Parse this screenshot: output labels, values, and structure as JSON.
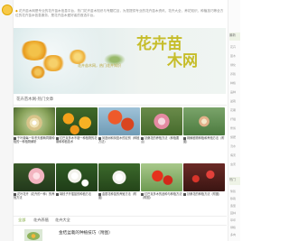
{
  "left_logo": "flower-logo-icon",
  "intro": {
    "mark": "◆",
    "text": "花卉苗木网是专业的花卉苗木信息平台，热门花卉苗木知识与专题栏目，为您提供专业的花卉苗木资讯、花卉大全、养花知识、种植技巧等全方位的花卉苗木信息服务，是花卉苗木爱好者的首选平台。"
  },
  "banner": {
    "title_line1": "花卉苗",
    "title_line2": "木网",
    "subtitle": "花卉苗木网，热门花卉知识",
    "slides": 4,
    "active_slide": 0
  },
  "section": {
    "title": "花卉苗木网-热门文章"
  },
  "articles": [
    {
      "caption": "千叶菊每一年冬天都两同期种植的一种植物解析"
    },
    {
      "caption": "红巴克多木不错一种植物的花期和种植技术"
    },
    {
      "caption": "凤凰树和凤凰木的区别（种植方法）"
    },
    {
      "caption": "扶桑花的养殖方法（种植要点）"
    },
    {
      "caption": "荆棘植物种植和养殖方法（附图）"
    },
    {
      "caption": "花叶花卉（花卉的一种）的养殖方法"
    },
    {
      "caption": "胡枝子扦插苗的种植方法"
    },
    {
      "caption": "金银花种苗的养殖方法（附图）"
    },
    {
      "caption": "红巴克多木的品种与种植方法（附图）"
    },
    {
      "caption": "扶桑花的种植方法（附图）"
    }
  ],
  "tabs": [
    {
      "label": "全部",
      "active": true
    },
    {
      "label": "花卉养殖",
      "active": false
    },
    {
      "label": "花卉大全",
      "active": false
    }
  ],
  "bottom": {
    "text": "金桔盆栽的种植技巧（附图）"
  },
  "right_col": {
    "head1": "最新",
    "head2": "热门",
    "items": [
      "花卉",
      "苗木",
      "绿化",
      "养殖",
      "种植",
      "品种",
      "盆栽",
      "花期",
      "扦插",
      "修剪",
      "施肥",
      "浇水",
      "病害",
      "虫害",
      "繁殖",
      "移栽",
      "造型",
      "园林",
      "草坪",
      "绿植",
      "多肉"
    ]
  },
  "colors": {
    "accent_green": "#76a332",
    "banner_gold": "#c6bd2a"
  }
}
